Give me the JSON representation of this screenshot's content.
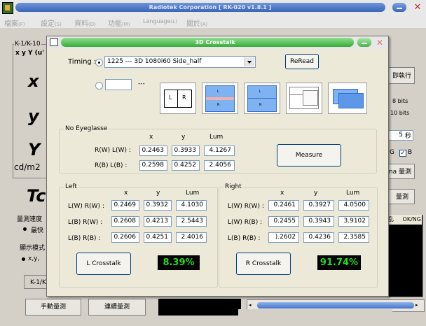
{
  "main_window": {
    "title": "Radiotek Corporation [ RK-020 v1.8.1 ]",
    "close_glyph": "✕",
    "menu": [
      {
        "label": "檔案",
        "key": "(F)"
      },
      {
        "label": "設定",
        "key": "(S)"
      },
      {
        "label": "資料",
        "key": "(D)"
      },
      {
        "label": "功能",
        "key": "(M)"
      },
      {
        "label": "Language",
        "key": "(L)"
      },
      {
        "label": "關於",
        "key": "(A)"
      }
    ],
    "left": {
      "group_label": "K-1/K-10",
      "header": "x y Y (u'",
      "x_big": "x",
      "y_big": "y",
      "Y_big": "Y",
      "unit": "cd/m2",
      "tc_big": "Tc",
      "speed_group": "量測速度",
      "speed_option": "最快",
      "display_mode_group": "顯示模式",
      "display_mode_option": "x,y,",
      "k_button": "K-1/K",
      "manual_measure": "手動量測",
      "continuous_measure": "連續量測"
    },
    "right": {
      "execute": "即執行",
      "bits_8": "8 bits",
      "bits_10": "10 bits",
      "seconds_value": "5",
      "seconds_unit": "秒",
      "g_label": "G",
      "b_label": "B",
      "gamma_measure": "ma 量測",
      "measure_btn": "量測",
      "col_a": "乱",
      "col_ok": "OK/NG"
    }
  },
  "dialog": {
    "title": "3D Crosstalk",
    "close_glyph": "✕",
    "timing_label": "Timing :",
    "timing_value": "1225 --- 3D 1080i60 Side_half",
    "reread": "ReRead",
    "custom_input": "",
    "custom_dash": "---",
    "icons": [
      "lr-side-by-side-icon",
      "top-bottom-interlaced-icon",
      "top-bottom-icon",
      "overlay-panels-icon",
      "stacked-frames-icon"
    ],
    "icon_letters": {
      "L": "L",
      "R": "R"
    },
    "no_eyeglasse": {
      "title": "No Eyeglasse",
      "cols": [
        "x",
        "y",
        "Lum"
      ],
      "rows": [
        {
          "label": "R(W) L(W) :",
          "x": "0.2463",
          "y": "0.3933",
          "lum": "4.1267"
        },
        {
          "label": "R(B) L(B) :",
          "x": "0.2598",
          "y": "0.4252",
          "lum": "2.4056"
        }
      ],
      "measure": "Measure"
    },
    "left": {
      "title": "Left",
      "cols": [
        "x",
        "y",
        "Lum"
      ],
      "rows": [
        {
          "label": "L(W) R(W) :",
          "x": "0.2469",
          "y": "0.3932",
          "lum": "4.1030"
        },
        {
          "label": "L(B) R(W) :",
          "x": "0.2608",
          "y": "0.4213",
          "lum": "2.5443"
        },
        {
          "label": "L(B) R(B) :",
          "x": "0.2606",
          "y": "0.4251",
          "lum": "2.4016"
        }
      ],
      "button": "L Crosstalk",
      "result": "8.39%"
    },
    "right": {
      "title": "Right",
      "cols": [
        "x",
        "y",
        "Lum"
      ],
      "rows": [
        {
          "label": "L(W) R(W) :",
          "x": "0.2461",
          "y": "0.3927",
          "lum": "4.0500"
        },
        {
          "label": "L(W) R(B) :",
          "x": "0.2455",
          "y": "0.3943",
          "lum": "3.9102"
        },
        {
          "label": "L(B) R(B) :",
          "x": ").2602",
          "y": "0.4236",
          "lum": "2.3585"
        }
      ],
      "button": "R Crosstalk",
      "result": "91.74%"
    }
  }
}
